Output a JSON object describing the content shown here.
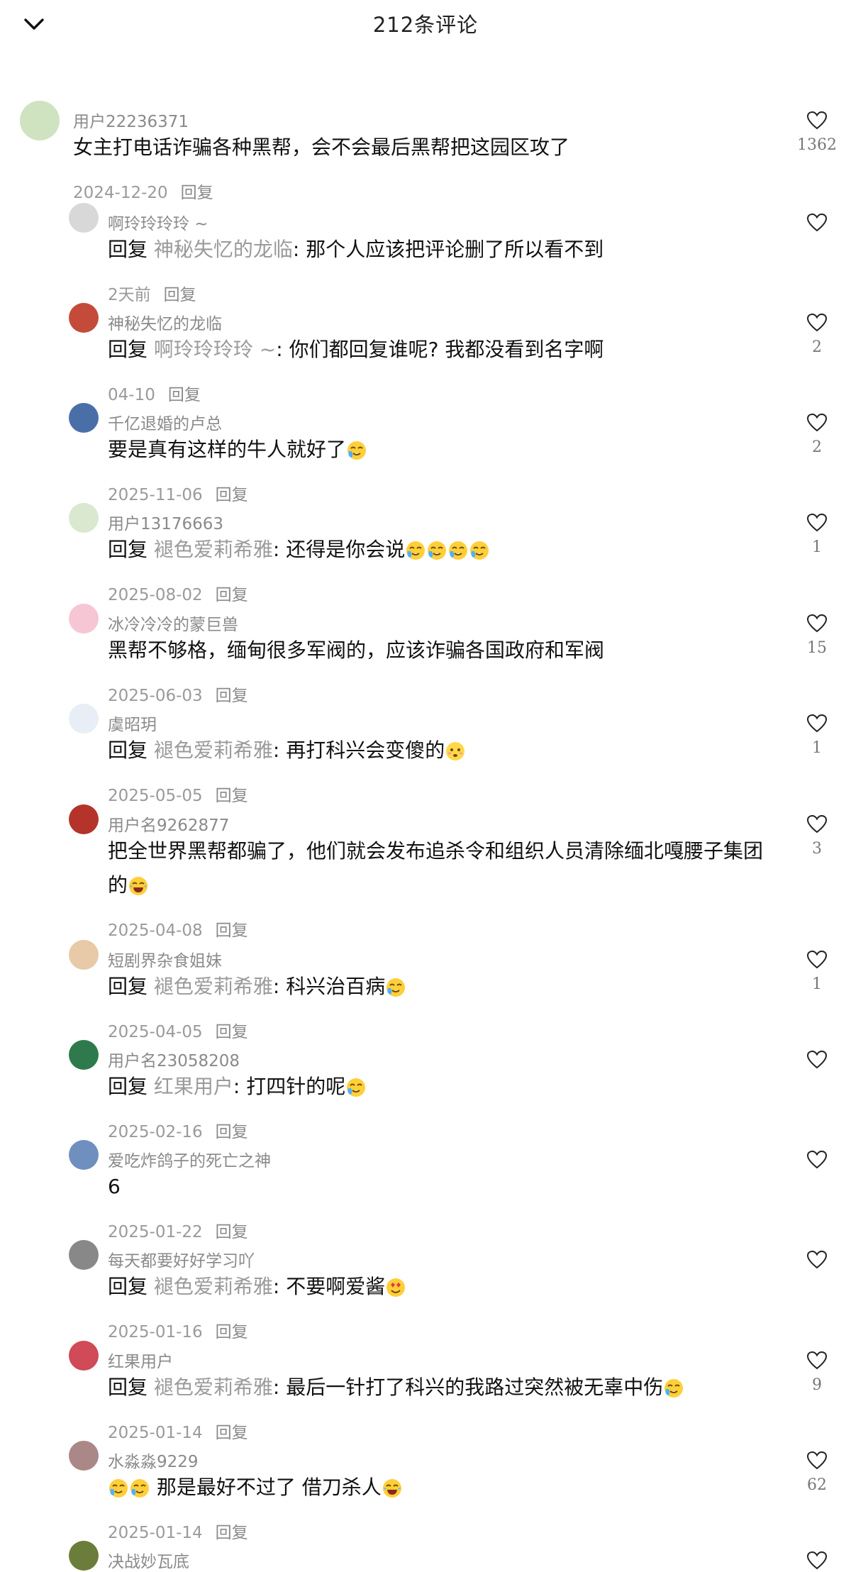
{
  "header": {
    "title": "212条评论"
  },
  "colors": {
    "text": "#111111",
    "muted": "#8a8a8a",
    "heart": "#222222"
  },
  "comments": [
    {
      "user": "用户22236371",
      "prefix": "",
      "mention": "",
      "body": "女主打电话诈骗各种黑帮，会不会最后黑帮把这园区攻了",
      "date": "2024-12-20",
      "reply": "回复",
      "likes": "1362",
      "emoji": []
    },
    {
      "user": "啊玲玲玲玲 ~",
      "prefix": "回复 ",
      "mention": "神秘失忆的龙临",
      "body": ": 那个人应该把评论删了所以看不到",
      "date": "2天前",
      "reply": "回复",
      "likes": "",
      "emoji": []
    },
    {
      "user": "神秘失忆的龙临",
      "prefix": "回复 ",
      "mention": "啊玲玲玲玲 ~",
      "body": ": 你们都回复谁呢? 我都没看到名字啊",
      "date": "04-10",
      "reply": "回复",
      "likes": "2",
      "emoji": []
    },
    {
      "user": "千亿退婚的卢总",
      "prefix": "",
      "mention": "",
      "body": "要是真有这样的牛人就好了",
      "date": "2025-11-06",
      "reply": "回复",
      "likes": "2",
      "emoji": [
        "cry-laugh-emoji"
      ]
    },
    {
      "user": "用户13176663",
      "prefix": "回复 ",
      "mention": "褪色爱莉希雅",
      "body": ": 还得是你会说",
      "date": "2025-08-02",
      "reply": "回复",
      "likes": "1",
      "emoji": [
        "cry-laugh-emoji",
        "cry-laugh-emoji",
        "cry-laugh-emoji",
        "cry-laugh-emoji"
      ]
    },
    {
      "user": "冰冷冷冷的蒙巨兽",
      "prefix": "",
      "mention": "",
      "body": "黑帮不够格，缅甸很多军阀的，应该诈骗各国政府和军阀",
      "date": "2025-06-03",
      "reply": "回复",
      "likes": "15",
      "emoji": []
    },
    {
      "user": "虞昭玥",
      "prefix": "回复 ",
      "mention": "褪色爱莉希雅",
      "body": ": 再打科兴会变傻的",
      "date": "2025-05-05",
      "reply": "回复",
      "likes": "1",
      "emoji": [
        "dizzy-face-emoji"
      ]
    },
    {
      "user": "用户名9262877",
      "prefix": "",
      "mention": "",
      "body": "把全世界黑帮都骗了，他们就会发布追杀令和组织人员清除缅北嘎腰子集团的",
      "date": "2025-04-08",
      "reply": "回复",
      "likes": "3",
      "emoji": [
        "laughing-emoji"
      ]
    },
    {
      "user": "短剧界杂食姐妹",
      "prefix": "回复 ",
      "mention": "褪色爱莉希雅",
      "body": ": 科兴治百病",
      "date": "2025-04-05",
      "reply": "回复",
      "likes": "1",
      "emoji": [
        "cry-laugh-emoji"
      ]
    },
    {
      "user": "用户名23058208",
      "prefix": "回复 ",
      "mention": "红果用户",
      "body": ": 打四针的呢",
      "date": "2025-02-16",
      "reply": "回复",
      "likes": "",
      "emoji": [
        "cry-laugh-emoji"
      ]
    },
    {
      "user": "爱吃炸鸽子的死亡之神",
      "prefix": "",
      "mention": "",
      "body": "6",
      "date": "2025-01-22",
      "reply": "回复",
      "likes": "",
      "emoji": []
    },
    {
      "user": "每天都要好好学习吖",
      "prefix": "回复 ",
      "mention": "褪色爱莉希雅",
      "body": ": 不要啊爱酱",
      "date": "2025-01-16",
      "reply": "回复",
      "likes": "",
      "emoji": [
        "heart-eyes-emoji"
      ]
    },
    {
      "user": "红果用户",
      "prefix": "回复 ",
      "mention": "褪色爱莉希雅",
      "body": ": 最后一针打了科兴的我路过突然被无辜中伤",
      "date": "2025-01-14",
      "reply": "回复",
      "likes": "9",
      "emoji": [
        "cry-laugh-emoji"
      ]
    },
    {
      "user": "水淼淼9229",
      "prefix": "",
      "mention": "",
      "body": " 那是最好不过了 借刀杀人",
      "date": "2025-01-14",
      "reply": "回复",
      "likes": "62",
      "emoji": [
        "cry-laugh-emoji",
        "cry-laugh-emoji",
        "laughing-emoji"
      ]
    },
    {
      "user": "决战妙瓦底",
      "prefix": "",
      "mention": "",
      "body": "",
      "date": "",
      "reply": "",
      "likes": "",
      "emoji": []
    }
  ]
}
